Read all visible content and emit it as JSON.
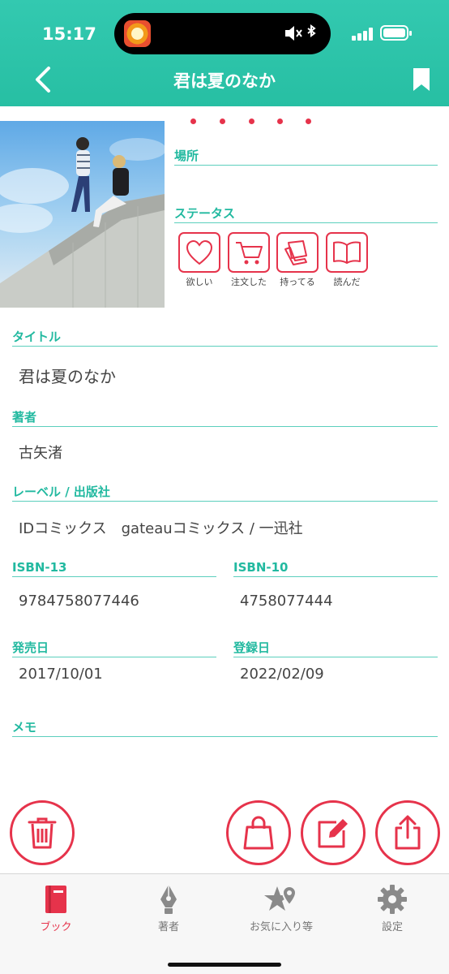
{
  "status_bar": {
    "time": "15:17"
  },
  "header": {
    "title": "君は夏のなか",
    "back_icon": "chevron-left-icon",
    "bookmark_icon": "bookmark-icon"
  },
  "colors": {
    "accent": "#27bfa3",
    "accent_light": "#5ccfbd",
    "red": "#e6334b",
    "tab_bg": "#f7f7f7"
  },
  "place": {
    "label": "場所",
    "value": ""
  },
  "status": {
    "label": "ステータス",
    "items": [
      {
        "label": "欲しい",
        "icon": "heart-icon"
      },
      {
        "label": "注文した",
        "icon": "cart-icon"
      },
      {
        "label": "持ってる",
        "icon": "hand-book-icon"
      },
      {
        "label": "読んだ",
        "icon": "open-book-icon"
      }
    ]
  },
  "fields": {
    "title": {
      "label": "タイトル",
      "value": "君は夏のなか"
    },
    "author": {
      "label": "著者",
      "value": "古矢渚"
    },
    "publisher": {
      "label": "レーベル / 出版社",
      "value": "IDコミックス　gateauコミックス / 一迅社"
    },
    "isbn13": {
      "label": "ISBN-13",
      "value": "9784758077446"
    },
    "isbn10": {
      "label": "ISBN-10",
      "value": "4758077444"
    },
    "release_date": {
      "label": "発売日",
      "value": "2017/10/01"
    },
    "register_date": {
      "label": "登録日",
      "value": "2022/02/09"
    },
    "memo": {
      "label": "メモ",
      "value": ""
    }
  },
  "actions": [
    {
      "name": "delete",
      "icon": "trash-icon"
    },
    {
      "name": "shop",
      "icon": "shopping-bag-icon"
    },
    {
      "name": "edit",
      "icon": "edit-icon"
    },
    {
      "name": "share",
      "icon": "share-icon"
    }
  ],
  "tabbar": {
    "tabs": [
      {
        "label": "ブック",
        "icon": "book-icon",
        "active": true
      },
      {
        "label": "著者",
        "icon": "pen-nib-icon",
        "active": false
      },
      {
        "label": "お気に入り等",
        "icon": "favorites-icon",
        "active": false
      },
      {
        "label": "設定",
        "icon": "gear-icon",
        "active": false
      }
    ]
  }
}
